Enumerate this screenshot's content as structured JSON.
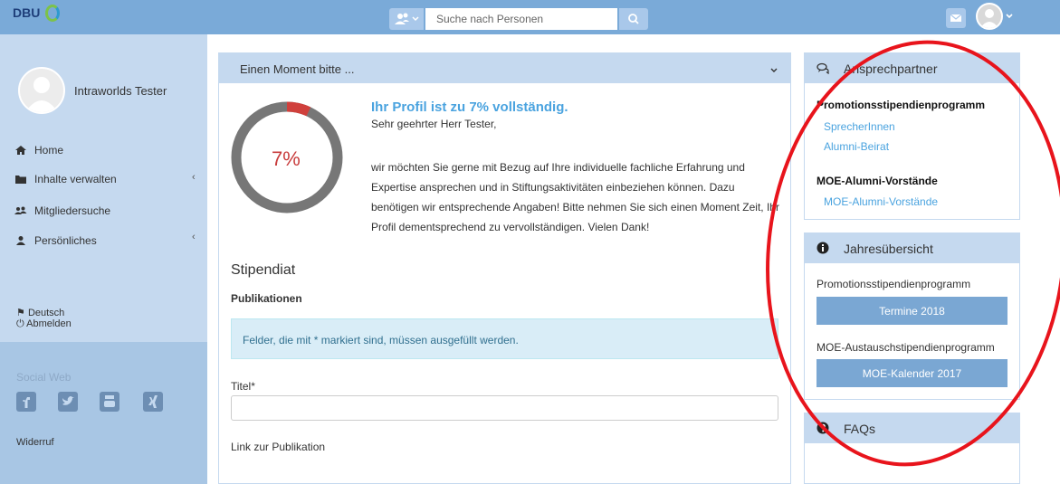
{
  "header": {
    "logo_text": "DBU",
    "search_placeholder": "Suche nach Personen"
  },
  "sidebar": {
    "user_name": "Intraworlds Tester",
    "items": [
      {
        "label": "Home",
        "icon": "home-icon"
      },
      {
        "label": "Inhalte verwalten",
        "icon": "folder-icon"
      },
      {
        "label": "Mitgliedersuche",
        "icon": "users-icon"
      },
      {
        "label": "Persönliches",
        "icon": "user-icon"
      }
    ],
    "language": "Deutsch",
    "logout": "Abmelden",
    "social_title": "Social Web",
    "social_icons": [
      "facebook-icon",
      "twitter-icon",
      "youtube-icon",
      "xing-icon"
    ],
    "widerruf": "Widerruf"
  },
  "main": {
    "header_title": "Einen Moment bitte ...",
    "progress_percent": 7,
    "progress_label": "7%",
    "progress_title": "Ihr Profil ist zu 7% vollständig.",
    "greeting": "Sehr geehrter Herr Tester,",
    "intro": "wir möchten Sie gerne mit Bezug auf Ihre individuelle fachliche Erfahrung und Expertise ansprechen und in Stiftungsaktivitäten einbeziehen können. Dazu benötigen wir entsprechende Angaben! Bitte nehmen Sie sich einen Moment Zeit, Ihr Profil dementsprechend zu vervollständigen. Vielen Dank!",
    "section_title": "Stipendiat",
    "subsection_title": "Publikationen",
    "info_text": "Felder, die mit * markiert sind, müssen ausgefüllt werden.",
    "field_title_label": "Titel*",
    "field_link_label": "Link zur Publikation"
  },
  "right": {
    "contacts": {
      "title": "Ansprechpartner",
      "group1_title": "Promotionsstipendienprogramm",
      "group1_links": [
        "SprecherInnen",
        "Alumni-Beirat"
      ],
      "group2_title": "MOE-Alumni-Vorstände",
      "group2_links": [
        "MOE-Alumni-Vorstände"
      ]
    },
    "overview": {
      "title": "Jahresübersicht",
      "program1": "Promotionsstipendienprogramm",
      "button1": "Termine 2018",
      "program2": "MOE-Austauschstipendienprogramm",
      "button2": "MOE-Kalender 2017"
    },
    "faq": {
      "title": "FAQs"
    }
  },
  "colors": {
    "topbar": "#7aaad8",
    "sidebar": "#c5d9ef",
    "accent_link": "#4aa3df",
    "progress_red": "#d0403c",
    "annotation_red": "#e8141c"
  }
}
